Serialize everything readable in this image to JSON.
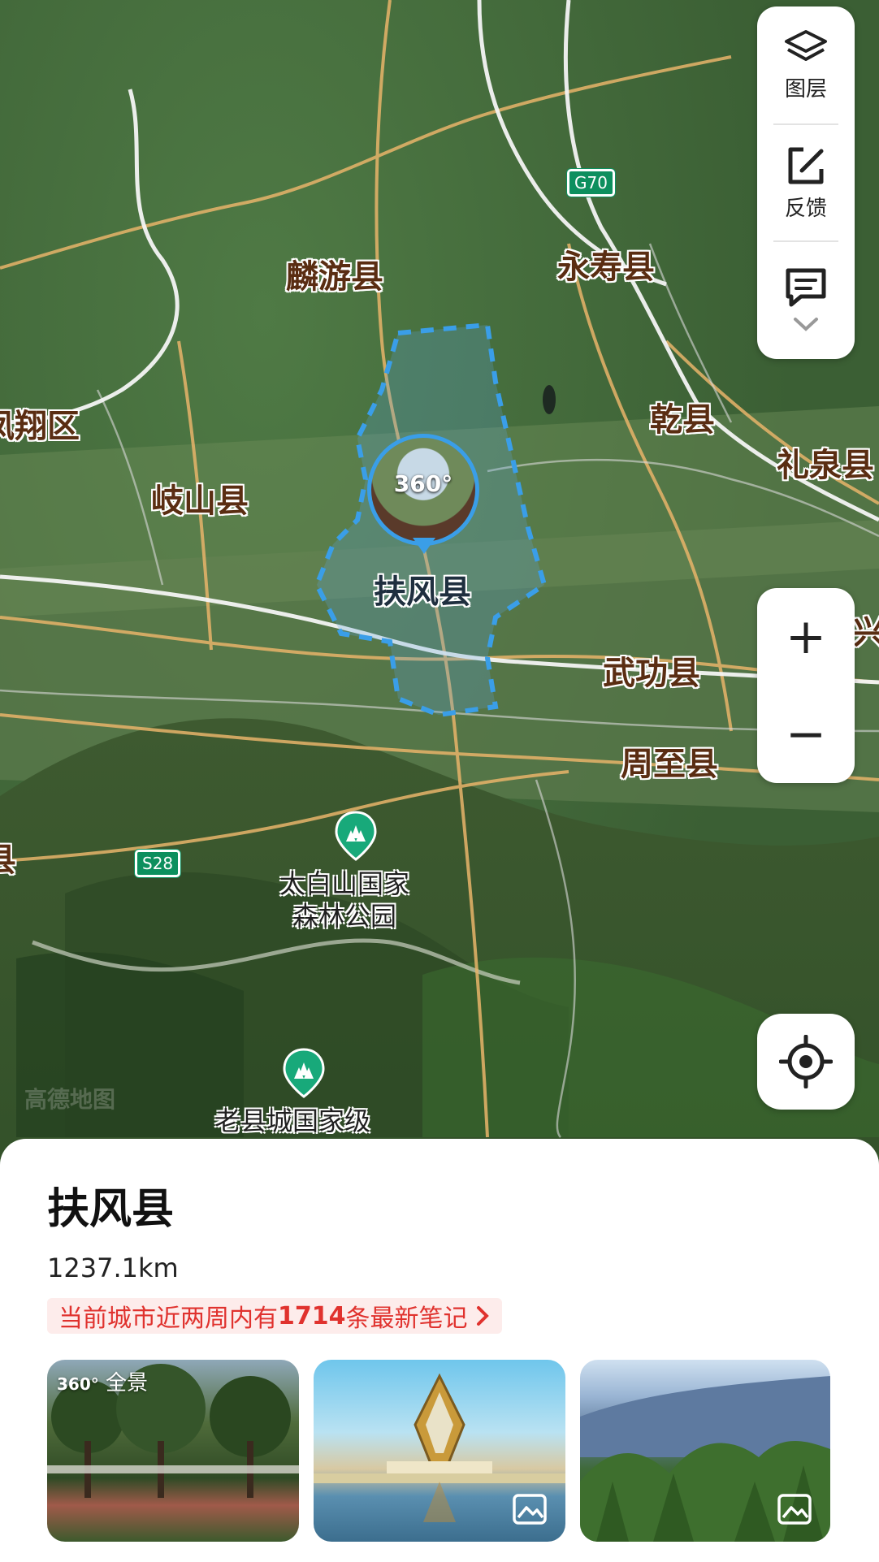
{
  "map": {
    "places": {
      "linyou": "麟游县",
      "yongshou": "永寿县",
      "fengxiang": "凤翔区",
      "qishan": "岐山县",
      "qianxian": "乾县",
      "liquan": "礼泉县",
      "fufeng": "扶风县",
      "wugong": "武功县",
      "zhouzhi": "周至县",
      "xingping": "兴平",
      "edge_left": "县"
    },
    "shields": {
      "g70": "G70",
      "s28": "S28"
    },
    "pois": {
      "taibaishan": [
        "太白山国家",
        "森林公园"
      ],
      "laoxiancheng": "老县城国家级"
    },
    "marker": {
      "badge": "360°",
      "icon": "panorama-marker-icon"
    },
    "watermark": "高德地图"
  },
  "toolbar": {
    "layers_label": "图层",
    "feedback_label": "反馈",
    "colors": {
      "background": "#ffffff",
      "icon": "#222222"
    }
  },
  "zoom": {
    "in": "+",
    "out": "−"
  },
  "panel": {
    "title": "扶风县",
    "distance": "1237.1km",
    "notes": {
      "prefix": "当前城市近两周内有",
      "count": "1714",
      "suffix": "条最新笔记"
    },
    "thumbs": [
      {
        "tag": "全景",
        "tag_icon": "360-icon"
      },
      {
        "icon": "image-icon"
      },
      {
        "icon": "image-icon"
      }
    ]
  },
  "colors": {
    "accent": "#e0322e",
    "boundary": "#3a9ee8",
    "road": "#e8b46a",
    "highway": "#ffffff"
  }
}
